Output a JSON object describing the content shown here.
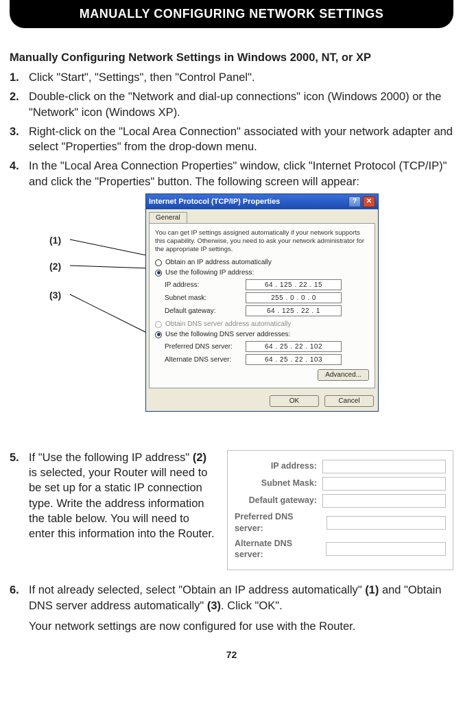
{
  "header": "MANUALLY CONFIGURING NETWORK SETTINGS",
  "subhead": "Manually Configuring Network Settings in Windows 2000, NT, or XP",
  "steps": {
    "s1": "Click \"Start\", \"Settings\", then \"Control Panel\".",
    "s2": "Double-click on the \"Network and dial-up connections\" icon (Windows 2000) or the \"Network\" icon (Windows XP).",
    "s3": "Right-click on the \"Local Area Connection\" associated with your network adapter and select \"Properties\" from the drop-down menu.",
    "s4": "In the \"Local Area Connection Properties\" window, click \"Internet Protocol (TCP/IP)\" and click the \"Properties\" button. The following screen will appear:",
    "s5_a": "If \"Use the following IP address\" ",
    "s5_b": "(2)",
    "s5_c": " is selected, your Router will need to be set up for a static IP connection type. Write the address information the table below. You will need to enter this information into the Router.",
    "s6_a": "If not already selected, select \"Obtain an IP address automatically\" ",
    "s6_b": "(1)",
    "s6_c": " and \"Obtain DNS server address automatically\" ",
    "s6_d": "(3)",
    "s6_e": ". Click \"OK\".",
    "s6_follow": "Your network settings are now configured for use with the Router."
  },
  "nums": {
    "n1": "1.",
    "n2": "2.",
    "n3": "3.",
    "n4": "4.",
    "n5": "5.",
    "n6": "6."
  },
  "callouts": {
    "c1": "(1)",
    "c2": "(2)",
    "c3": "(3)"
  },
  "dialog": {
    "title": "Internet Protocol (TCP/IP) Properties",
    "helpglyph": "?",
    "closeglyph": "✕",
    "tab": "General",
    "note": "You can get IP settings assigned automatically if your network supports this capability. Otherwise, you need to ask your network administrator for the appropriate IP settings.",
    "r_auto_ip": "Obtain an IP address automatically",
    "r_use_ip": "Use the following IP address:",
    "f_ip": "IP address:",
    "f_mask": "Subnet mask:",
    "f_gw": "Default gateway:",
    "v_ip": "64 . 125 .  22 .  15",
    "v_mask": "255 .   0 .   0 .   0",
    "v_gw": "64 . 125 .  22 .   1",
    "r_auto_dns": "Obtain DNS server address automatically",
    "r_use_dns": "Use the following DNS server addresses:",
    "f_pdns": "Preferred DNS server:",
    "f_adns": "Alternate DNS server:",
    "v_pdns": "64 .  25 .  22 . 102",
    "v_adns": "64 .  25 .  22 . 103",
    "advanced": "Advanced...",
    "ok": "OK",
    "cancel": "Cancel"
  },
  "blanks": {
    "ip": "IP address:",
    "mask": "Subnet Mask:",
    "gw": "Default gateway:",
    "pdns": "Preferred DNS server:",
    "adns": "Alternate DNS server:"
  },
  "pagefoot": "72"
}
